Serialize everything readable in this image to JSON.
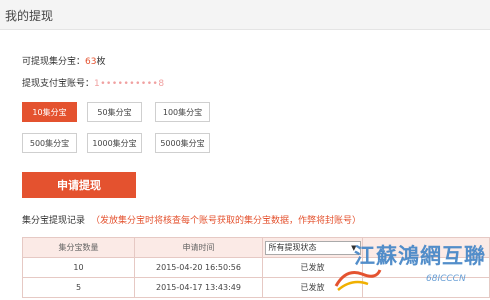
{
  "page": {
    "title": "我的提现"
  },
  "balance": {
    "label": "可提现集分宝：",
    "value": "63",
    "unit": "枚"
  },
  "account": {
    "label": "提现支付宝账号：",
    "masked_value": "1••••••••••8"
  },
  "amounts": [
    {
      "label": "10集分宝",
      "selected": true
    },
    {
      "label": "50集分宝",
      "selected": false
    },
    {
      "label": "100集分宝",
      "selected": false
    },
    {
      "label": "500集分宝",
      "selected": false
    },
    {
      "label": "1000集分宝",
      "selected": false
    },
    {
      "label": "5000集分宝",
      "selected": false
    }
  ],
  "apply_button": "申请提现",
  "records": {
    "title": "集分宝提现记录",
    "note": "（发放集分宝时将核查每个账号获取的集分宝数据，作弊将封账号）",
    "columns": [
      "集分宝数量",
      "申请时间",
      "",
      ""
    ],
    "filter": {
      "selected": "所有提现状态"
    },
    "rows": [
      {
        "amount": "10",
        "time": "2015-04-20 16:50:56",
        "status": "已发放"
      },
      {
        "amount": "5",
        "time": "2015-04-17 13:43:49",
        "status": "已发放"
      }
    ]
  },
  "watermark": {
    "text": "江蘇鴻網互聯",
    "url": "68ICCCN"
  },
  "colors": {
    "accent": "#e4522f",
    "header_bg": "#fbeae6",
    "topbar_bg": "#f4f4f4"
  }
}
